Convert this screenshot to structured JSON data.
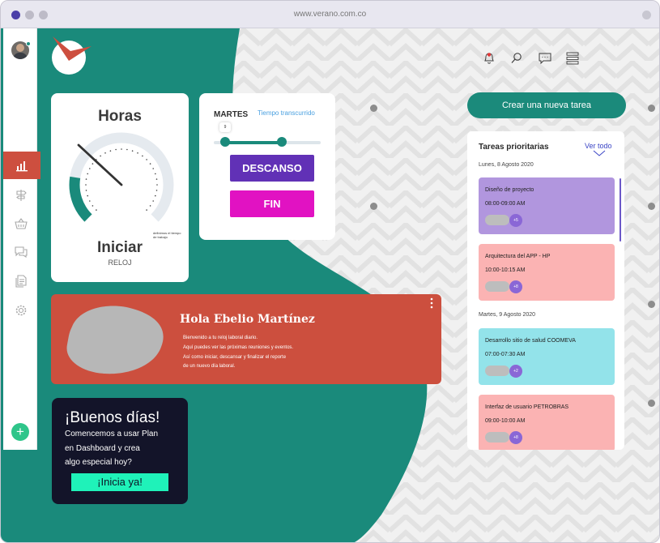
{
  "browser": {
    "url": "www.verano.com.co",
    "dot_colors": [
      "#4b3fa8",
      "#bdbbc7",
      "#bdbbc7"
    ]
  },
  "colors": {
    "teal": "#1a8a7b",
    "coral": "#cc4f3e",
    "purple": "#6131b6",
    "magenta": "#e112c2",
    "navy": "#131429",
    "mint": "#1ff2b9"
  },
  "sidebar": {
    "items": [
      {
        "icon": "bar-chart-icon",
        "active": true
      },
      {
        "icon": "signpost-icon",
        "active": false
      },
      {
        "icon": "basket-icon",
        "active": false
      },
      {
        "icon": "chat-icon",
        "active": false
      },
      {
        "icon": "documents-icon",
        "active": false
      },
      {
        "icon": "gear-icon",
        "active": false
      }
    ],
    "add_label": "+"
  },
  "header": {
    "icons": [
      "bell-icon",
      "search-icon",
      "message-icon",
      "menu-icon"
    ]
  },
  "horas_card": {
    "title": "Horas",
    "gauge_note": "definimos el tiempo de trabajo",
    "action": "Iniciar",
    "subtitle": "RELOJ",
    "gauge_level": 0.2
  },
  "martes_card": {
    "day": "MARTES",
    "elapsed_label": "Tiempo transcurrido",
    "slider_value": "9",
    "descanso_label": "DESCANSO",
    "fin_label": "FIN"
  },
  "hola_card": {
    "title": "Hola Ebelio Martínez",
    "lines": [
      "Bienvenido a tu reloj laboral diario.",
      "Aquí puedes ver las próximas reuniones y eventos.",
      "Así como iniciar, descansar y finalizar el reporte",
      "de un nuevo día laboral."
    ]
  },
  "buenos_card": {
    "title": "¡Buenos días!",
    "lines": [
      "Comencemos a usar Plan",
      "en Dashboard y crea",
      "algo especial hoy?"
    ],
    "button": "¡Inicia ya!"
  },
  "right": {
    "crear_button": "Crear una nueva tarea",
    "tareas": {
      "title": "Tareas prioritarias",
      "ver_todo": "Ver todo",
      "dates": [
        "Lunes, 8 Agosto 2020",
        "Martes, 9 Agosto 2020"
      ],
      "tasks": [
        {
          "name": "Diseño de proyecto",
          "time": "08:00-09:00 AM",
          "badge": "+5",
          "color": "#b196de"
        },
        {
          "name": "Arquitectura del APP - HP",
          "time": "10:00-10:15 AM",
          "badge": "+8",
          "color": "#fbb3b3"
        },
        {
          "name": "Desarrollo sitio de salud COOMEVA",
          "time": "07:00-07:30 AM",
          "badge": "+2",
          "color": "#93e3ea"
        },
        {
          "name": "Interfaz de usuario PETROBRAS",
          "time": "09:00-10:00 AM",
          "badge": "+8",
          "color": "#fbb3b3"
        }
      ]
    }
  }
}
